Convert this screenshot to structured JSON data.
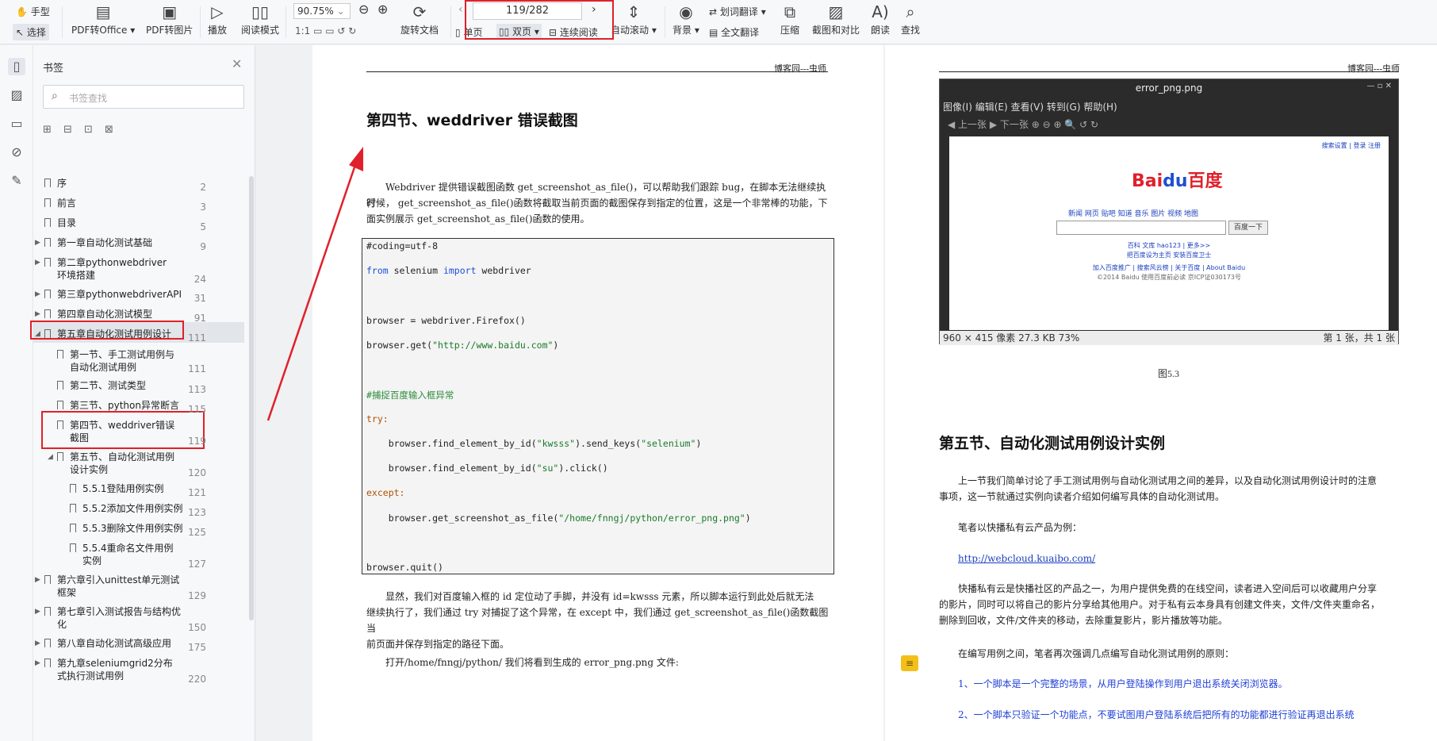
{
  "toolbar": {
    "hand": "手型",
    "select": "选择",
    "pdf_to_office": "PDF转Office",
    "pdf_to_image": "PDF转图片",
    "play": "播放",
    "read_mode": "阅读模式",
    "zoom": "90.75%",
    "rotate": "旋转文档",
    "page_indicator": "119/282",
    "single_page": "单页",
    "double_page": "双页",
    "continuous": "连续阅读",
    "auto_scroll": "自动滚动",
    "background": "背景",
    "word_translate": "划词翻译",
    "full_translate": "全文翻译",
    "compress": "压缩",
    "screenshot_compare": "截图和对比",
    "read_aloud": "朗读",
    "find": "查找"
  },
  "sidebar": {
    "title": "书签",
    "search_placeholder": "书签查找",
    "items": [
      {
        "label": "序",
        "page": "2"
      },
      {
        "label": "前言",
        "page": "3"
      },
      {
        "label": "目录",
        "page": "5"
      },
      {
        "label": "第一章自动化测试基础",
        "page": "9"
      },
      {
        "label": "第二章pythonwebdriver环境搭建",
        "page": "24"
      },
      {
        "label": "第三章pythonwebdriverAPI",
        "page": "31"
      },
      {
        "label": "第四章自动化测试模型",
        "page": "91"
      },
      {
        "label": "第五章自动化测试用例设计",
        "page": "111"
      },
      {
        "label": "第一节、手工测试用例与自动化测试用例",
        "page": "111"
      },
      {
        "label": "第二节、测试类型",
        "page": "113"
      },
      {
        "label": "第三节、python异常断言",
        "page": "115"
      },
      {
        "label": "第四节、weddriver错误截图",
        "page": "119"
      },
      {
        "label": "第五节、自动化测试用例设计实例",
        "page": "120"
      },
      {
        "label": "5.5.1登陆用例实例",
        "page": "121"
      },
      {
        "label": "5.5.2添加文件用例实例",
        "page": "123"
      },
      {
        "label": "5.5.3删除文件用例实例",
        "page": "125"
      },
      {
        "label": "5.5.4重命名文件用例实例",
        "page": "127"
      },
      {
        "label": "第六章引入unittest单元测试框架",
        "page": "129"
      },
      {
        "label": "第七章引入测试报告与结构优化",
        "page": "150"
      },
      {
        "label": "第八章自动化测试高级应用",
        "page": "175"
      },
      {
        "label": "第九章seleniumgrid2分布式执行测试用例",
        "page": "220"
      }
    ]
  },
  "left_page": {
    "header": "博客园---虫师",
    "heading": "第四节、weddriver 错误截图",
    "intro": [
      "Webdriver 提供错误截图函数 get_screenshot_as_file()，可以帮助我们跟踪 bug，在脚本无法继续执行",
      "时候， get_screenshot_as_file()函数将截取当前页面的截图保存到指定的位置，这是一个非常棒的功能，下",
      "面实例展示 get_screenshot_as_file()函数的使用。"
    ],
    "code": {
      "l1": "#coding=utf-8",
      "l2a": "from",
      "l2b": " selenium ",
      "l2c": "import",
      "l2d": " webdriver",
      "l3": "browser = webdriver.Firefox()",
      "l4a": "browser.get(",
      "l4b": "\"http://www.baidu.com\"",
      "l4c": ")",
      "l5": "#捕捉百度输入框异常",
      "l6": "try:",
      "l7a": "    browser.find_element_by_id(",
      "l7b": "\"kwsss\"",
      "l7c": ").send_keys(",
      "l7d": "\"selenium\"",
      "l7e": ")",
      "l8a": "    browser.find_element_by_id(",
      "l8b": "\"su\"",
      "l8c": ").click()",
      "l9": "except:",
      "l10a": "    browser.get_screenshot_as_file(",
      "l10b": "\"/home/fnngj/python/error_png.png\"",
      "l10c": ")",
      "l11": "browser.quit()"
    },
    "after": [
      "显然，我们对百度输入框的 id 定位动了手脚，并没有 id=kwsss 元素，所以脚本运行到此处后就无法",
      "继续执行了，我们通过 try 对捕捉了这个异常，在 except 中，我们通过 get_screenshot_as_file()函数截图当",
      "前页面并保存到指定的路径下面。"
    ],
    "open_line": "打开/home/fnngj/python/ 我们将看到生成的 error_png.png 文件:"
  },
  "right_page": {
    "header": "博客园---虫师",
    "viewer": {
      "title": "error_png.png",
      "menu": "图像(I)  编辑(E)  查看(V)  转到(G)  帮助(H)",
      "toolbar": "◀ 上一张   ▶ 下一张     ⊕  ⊖  ⊕  🔍     ↺  ↻",
      "status_left": "960 × 415 像素  27.3 KB   73%",
      "status_right": "第 1 张，共 1 张",
      "logo_a": "Bai",
      "logo_b": "du",
      "logo_c": "百度",
      "nav": "新闻  网页  贴吧  知道  音乐  图片  视频  地图",
      "button": "百度一下",
      "links1": "百科   文库   hao123 | 更多>>",
      "links2": "把百度设为主页  安装百度卫士",
      "links3": "加入百度推广 | 搜索风云榜 | 关于百度 | About Baidu",
      "links4": "©2014 Baidu 使用百度前必读 京ICP证030173号",
      "topright": "搜索设置 | 登录 注册"
    },
    "caption": "图5.3",
    "heading": "第五节、自动化测试用例设计实例",
    "p1a": "上一节我们简单讨论了手工测试用例与自动化测试用之间的差异，以及自动化测试用例设计时的注意",
    "p1b": "事项，这一节就通过实例向读者介绍如何编写具体的自动化测试用。",
    "p2": "笔者以快播私有云产品为例：",
    "link": "http://webcloud.kuaibo.com/",
    "p3a": "快播私有云是快播社区的产品之一，为用户提供免费的在线空间，读者进入空间后可以收藏用户分享",
    "p3b": "的影片，同时可以将自己的影片分享给其他用户。对于私有云本身具有创建文件夹，文件/文件夹重命名，",
    "p3c": "删除到回收，文件/文件夹的移动，去除重复影片，影片播放等功能。",
    "p4": "在编写用例之间，笔者再次强调几点编写自动化测试用例的原则：",
    "b1": "1、一个脚本是一个完整的场景，从用户登陆操作到用户退出系统关闭浏览器。",
    "b2": "2、一个脚本只验证一个功能点，不要试图用户登陆系统后把所有的功能都进行验证再退出系统"
  },
  "colors": {
    "highlight": "#e0202a",
    "link": "#1a3fbf"
  }
}
